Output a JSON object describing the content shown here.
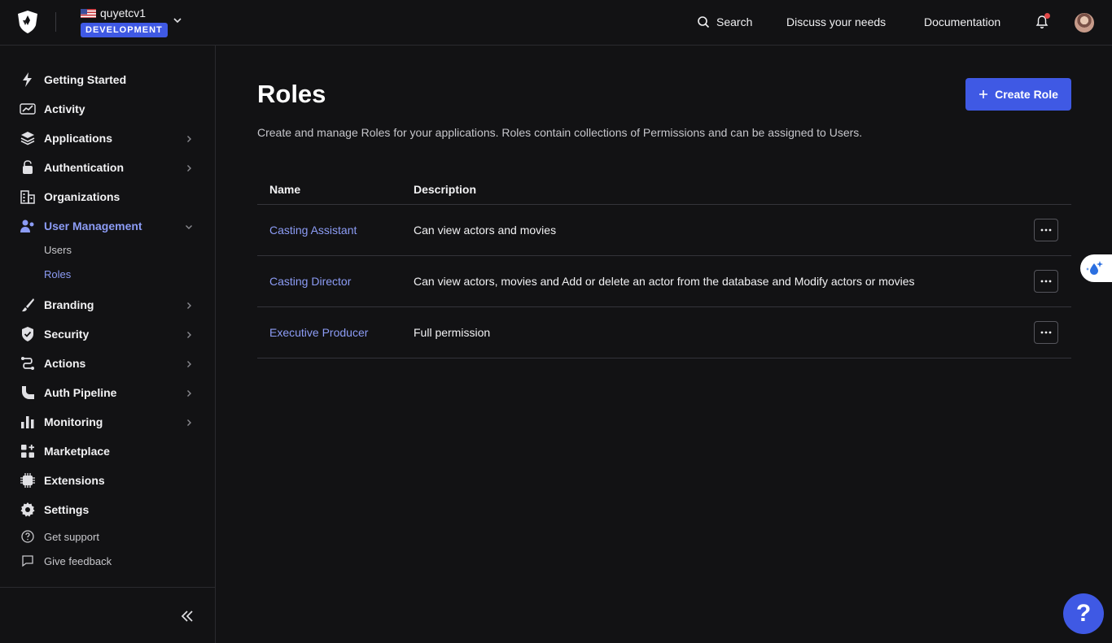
{
  "tenant": {
    "name": "quyetcv1",
    "environment": "DEVELOPMENT"
  },
  "topnav": {
    "search_label": "Search",
    "discuss_label": "Discuss your needs",
    "docs_label": "Documentation"
  },
  "sidebar": {
    "items": [
      {
        "label": "Getting Started",
        "icon": "bolt-icon",
        "has_chevron": false
      },
      {
        "label": "Activity",
        "icon": "trend-chart-icon",
        "has_chevron": false
      },
      {
        "label": "Applications",
        "icon": "layers-icon",
        "has_chevron": true
      },
      {
        "label": "Authentication",
        "icon": "lock-icon",
        "has_chevron": true
      },
      {
        "label": "Organizations",
        "icon": "building-icon",
        "has_chevron": false
      },
      {
        "label": "User Management",
        "icon": "users-icon",
        "has_chevron": true,
        "expanded": true
      },
      {
        "label": "Branding",
        "icon": "brush-icon",
        "has_chevron": true
      },
      {
        "label": "Security",
        "icon": "shield-check-icon",
        "has_chevron": true
      },
      {
        "label": "Actions",
        "icon": "flow-icon",
        "has_chevron": true
      },
      {
        "label": "Auth Pipeline",
        "icon": "pipeline-icon",
        "has_chevron": true
      },
      {
        "label": "Monitoring",
        "icon": "bar-chart-icon",
        "has_chevron": true
      },
      {
        "label": "Marketplace",
        "icon": "grid-plus-icon",
        "has_chevron": false
      },
      {
        "label": "Extensions",
        "icon": "chip-icon",
        "has_chevron": false
      },
      {
        "label": "Settings",
        "icon": "gear-icon",
        "has_chevron": false
      }
    ],
    "user_management_sub": [
      "Users",
      "Roles"
    ],
    "active_sub": "Roles",
    "footer": [
      "Get support",
      "Give feedback"
    ]
  },
  "main": {
    "title": "Roles",
    "create_button_label": "Create Role",
    "description": "Create and manage Roles for your applications. Roles contain collections of Permissions and can be assigned to Users.",
    "table": {
      "headers": [
        "Name",
        "Description"
      ],
      "rows": [
        {
          "name": "Casting Assistant",
          "description": "Can view actors and movies"
        },
        {
          "name": "Casting Director",
          "description": "Can view actors, movies and Add or delete an actor from the database and Modify actors or movies"
        },
        {
          "name": "Executive Producer",
          "description": "Full permission"
        }
      ]
    }
  },
  "help_button_label": "?",
  "colors": {
    "accent": "#3f59e4",
    "link": "#8c9cf5",
    "background": "#121214",
    "notification_dot": "#e04848"
  }
}
